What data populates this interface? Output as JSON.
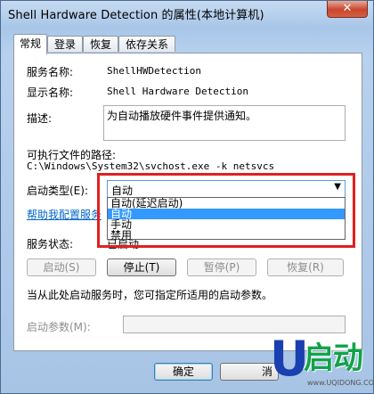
{
  "window": {
    "title": "Shell Hardware Detection 的属性(本地计算机)",
    "close_glyph": "✕"
  },
  "tabs": [
    {
      "label": "常规",
      "active": true
    },
    {
      "label": "登录",
      "active": false
    },
    {
      "label": "恢复",
      "active": false
    },
    {
      "label": "依存关系",
      "active": false
    }
  ],
  "general": {
    "service_name_label": "服务名称:",
    "service_name_value": "ShellHWDetection",
    "display_name_label": "显示名称:",
    "display_name_value": "Shell Hardware Detection",
    "description_label": "描述:",
    "description_value": "为自动播放硬件事件提供通知。",
    "exe_path_label": "可执行文件的路径:",
    "exe_path_value": "C:\\Windows\\System32\\svchost.exe -k netsvcs",
    "startup_type_label": "启动类型(E):",
    "startup_type_selected": "自动",
    "startup_options": [
      "自动(延迟启动)",
      "自动",
      "手动",
      "禁用"
    ],
    "startup_option_highlighted": "自动",
    "help_link_partial": "帮助我配置服务",
    "status_label": "服务状态:",
    "status_value": "已启动",
    "hint_text": "当从此处启动服务时，您可指定所适用的启动参数。",
    "start_params_label": "启动参数(M):",
    "start_params_value": ""
  },
  "buttons": {
    "start": "启动(S)",
    "stop": "停止(T)",
    "pause": "暂停(P)",
    "resume": "恢复(R)",
    "ok": "确定",
    "cancel_partial": "消"
  },
  "icons": {
    "dropdown_arrow": "▼"
  },
  "watermark": {
    "logo_letter": "U",
    "logo_text": "启动",
    "url": "www.UQIDONG.COM"
  },
  "colors": {
    "selection": "#3399ff",
    "highlight_box": "#e02020",
    "link": "#0066cc"
  }
}
